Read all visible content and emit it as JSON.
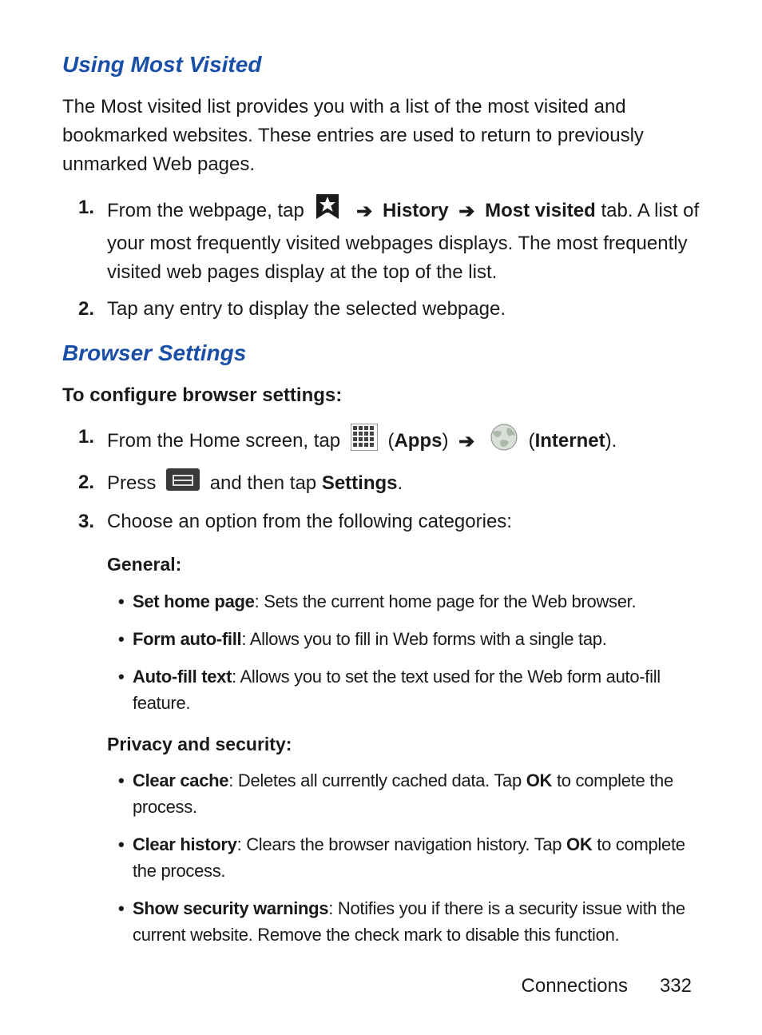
{
  "section1": {
    "heading": "Using Most Visited",
    "intro": "The Most visited list provides you with a list of the most visited and bookmarked websites. These entries are used to return to previously unmarked Web pages.",
    "steps": [
      {
        "num": "1.",
        "pre": "From the webpage, tap ",
        "history": "History",
        "mostvisited": "Most visited",
        "tab": " tab. A list of your most frequently visited webpages displays. The most frequently visited web pages display at the top of the list."
      },
      {
        "num": "2.",
        "text": "Tap any entry to display the selected webpage."
      }
    ]
  },
  "section2": {
    "heading": "Browser Settings",
    "subheading": "To configure browser settings:",
    "steps": [
      {
        "num": "1.",
        "pre": "From the Home screen, tap ",
        "apps_open": " (",
        "apps": "Apps",
        "apps_close": ") ",
        "internet_open": " (",
        "internet": "Internet",
        "internet_close": ")."
      },
      {
        "num": "2.",
        "pre": "Press ",
        "mid": " and then tap ",
        "settings": "Settings",
        "post": "."
      },
      {
        "num": "3.",
        "text": "Choose an option from the following categories:"
      }
    ],
    "categories": [
      {
        "title": "General:",
        "items": [
          {
            "label": "Set home page",
            "desc": ": Sets the current home page for the Web browser."
          },
          {
            "label": "Form auto-fill",
            "desc": ": Allows you to fill in Web forms with a single tap."
          },
          {
            "label": "Auto-fill text",
            "desc": ": Allows you to set the text used for the Web form auto-fill feature."
          }
        ]
      },
      {
        "title": "Privacy and security:",
        "items": [
          {
            "label": "Clear cache",
            "desc_pre": ": Deletes all currently cached data. Tap ",
            "ok": "OK",
            "desc_post": " to complete the process."
          },
          {
            "label": "Clear history",
            "desc_pre": ": Clears the browser navigation history. Tap ",
            "ok": "OK",
            "desc_post": " to complete the process."
          },
          {
            "label": "Show security warnings",
            "desc": ": Notifies you if there is a security issue with the current website. Remove the check mark to disable this function."
          }
        ]
      }
    ]
  },
  "footer": {
    "section": "Connections",
    "page": "332"
  }
}
